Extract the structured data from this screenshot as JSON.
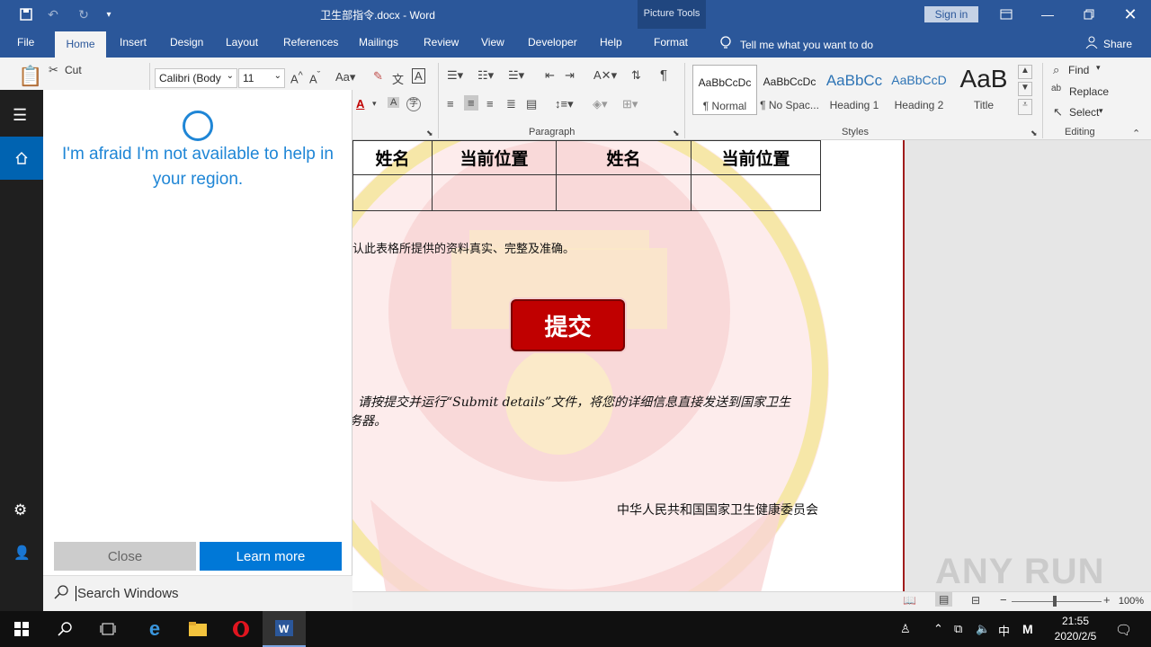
{
  "window": {
    "doc_title": "卫生部指令.docx - Word",
    "context_tab_group": "Picture Tools",
    "sign_in": "Sign in"
  },
  "tabs": [
    "File",
    "Home",
    "Insert",
    "Design",
    "Layout",
    "References",
    "Mailings",
    "Review",
    "View",
    "Developer",
    "Help",
    "Format"
  ],
  "tell_me": "Tell me what you want to do",
  "share": "Share",
  "ribbon": {
    "clipboard": {
      "cut": "Cut"
    },
    "font": {
      "name": "Calibri (Body",
      "size": "11"
    },
    "groups": {
      "paragraph": "Paragraph",
      "styles": "Styles",
      "editing": "Editing"
    },
    "styles": [
      {
        "sample": "AaBbCcDc",
        "label": "¶ Normal"
      },
      {
        "sample": "AaBbCcDc",
        "label": "¶ No Spac..."
      },
      {
        "sample": "AaBbCc",
        "label": "Heading 1"
      },
      {
        "sample": "AaBbCcD",
        "label": "Heading 2"
      },
      {
        "sample": "AaB",
        "label": "Title"
      }
    ],
    "editing": {
      "find": "Find",
      "replace": "Replace",
      "select": "Select"
    }
  },
  "document": {
    "table_headers": [
      "姓名",
      "当前位置",
      "姓名",
      "当前位置"
    ],
    "confirm_text": "认此表格所提供的资料真实、完整及准确。",
    "submit_label": "提交",
    "instruction_line1": "请按提交并运行“Submit details”文件，将您的详细信息直接发送到国家卫生",
    "instruction_line2": "务器。",
    "signature": "中华人民共和国国家卫生健康委员会"
  },
  "statusbar": {
    "zoom": "100%"
  },
  "cortana": {
    "message": "I'm afraid I'm not available to help in your region.",
    "close": "Close",
    "learn_more": "Learn more",
    "search_placeholder": "Search Windows"
  },
  "taskbar": {
    "time": "21:55",
    "date": "2020/2/5",
    "ime": "中",
    "ime2": "M"
  },
  "watermark": "ANY RUN"
}
